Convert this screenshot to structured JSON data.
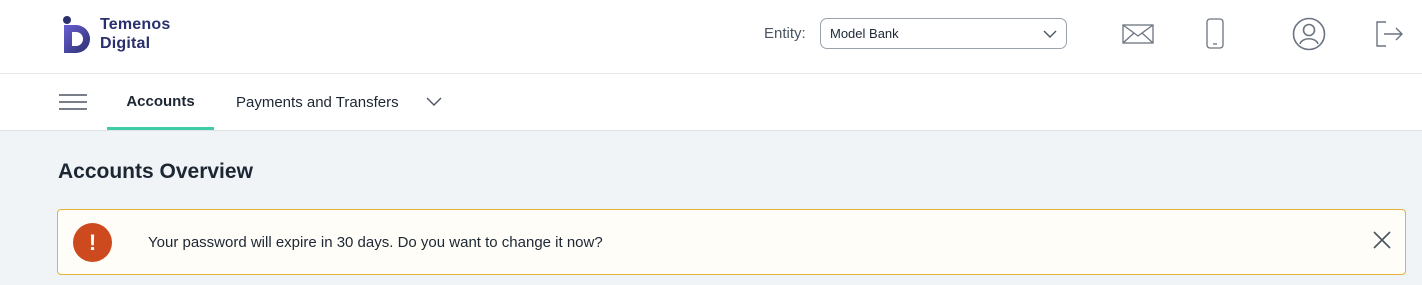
{
  "header": {
    "logo_line1": "Temenos",
    "logo_line2": "Digital",
    "entity_label": "Entity:",
    "entity_value": "Model Bank"
  },
  "icons": {
    "messages": "envelope-icon",
    "mobile": "phone-icon",
    "profile": "user-icon",
    "logout": "logout-icon",
    "menu": "hamburger-icon",
    "dropdown": "chevron-down-icon",
    "alert": "exclamation-icon",
    "close": "close-icon"
  },
  "nav": {
    "tabs": [
      {
        "label": "Accounts",
        "active": true
      },
      {
        "label": "Payments and Transfers",
        "active": false
      }
    ]
  },
  "main": {
    "title": "Accounts Overview",
    "alert": {
      "badge": "!",
      "message": "Your password will expire in 30 days. Do you want to change it now?"
    }
  },
  "colors": {
    "accent_tab": "#3fcca6",
    "alert_border": "#e5b23a",
    "alert_badge": "#cc4a1e",
    "brand": "#2a2f6e"
  }
}
